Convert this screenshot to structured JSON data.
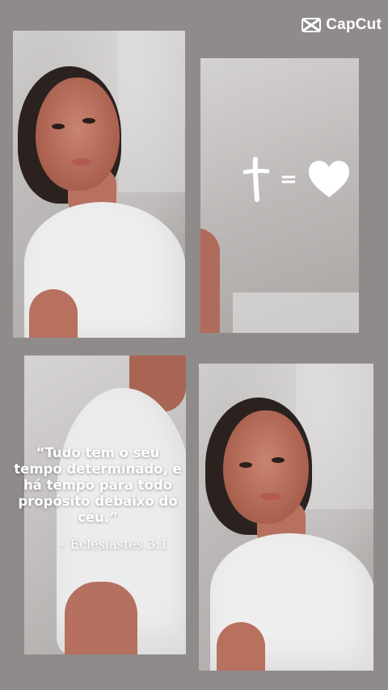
{
  "watermark": {
    "brand": "CapCut",
    "icon": "capcut-logo-icon"
  },
  "symbols": {
    "cross": "cross-icon",
    "equals": "=",
    "heart": "heart-icon"
  },
  "quote": {
    "text": "“Tudo tem o seu tempo determinado, e há tempo para todo propósito debaixo do céu.”",
    "reference": "- Eclesiastes 3:1"
  },
  "colors": {
    "background": "#8f8b8a",
    "text": "#ffffff",
    "shirt": "#eeeeee"
  }
}
